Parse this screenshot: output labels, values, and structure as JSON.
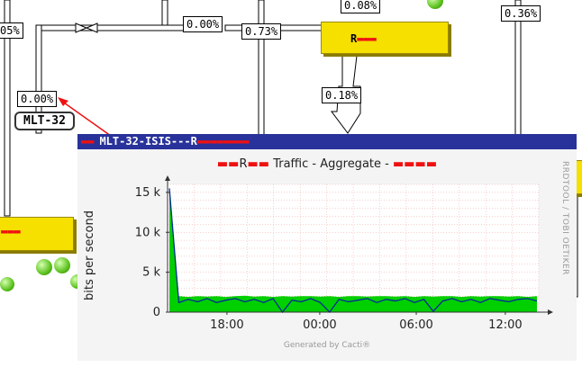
{
  "map": {
    "labels": [
      {
        "id": "lbl-top-left",
        "text": "05%"
      },
      {
        "id": "lbl-top-mid",
        "text": "0.00%"
      },
      {
        "id": "lbl-top-mid2",
        "text": "0.73%"
      },
      {
        "id": "lbl-top-r",
        "text": "0.08%"
      },
      {
        "id": "lbl-top-far",
        "text": "0.36%"
      },
      {
        "id": "lbl-left-mid",
        "text": "0.00%"
      },
      {
        "id": "lbl-center",
        "text": "0.18%"
      }
    ],
    "node_tag": "MLT-32",
    "node_r_prefix": "R"
  },
  "graph": {
    "window_title": "MLT-32-ISIS---R",
    "title_prefix": "R",
    "title_main": "Traffic - Aggregate -",
    "ylabel": "bits per second",
    "side_label": "RRDTOOL / TOBI OETIKER",
    "footer": "Generated by Cacti®",
    "colors": {
      "inbound": "#00cf00",
      "outbound": "#002a97"
    }
  },
  "chart_data": {
    "type": "area",
    "ylabel": "bits per second",
    "yticks": [
      "15 k",
      "10 k",
      "5 k",
      "0"
    ],
    "ytick_values": [
      15000,
      10000,
      5000,
      0
    ],
    "xticks": [
      "18:00",
      "00:00",
      "06:00",
      "12:00"
    ],
    "ylim": [
      0,
      16000
    ],
    "grid": true,
    "series": [
      {
        "name": "",
        "color": "#00cf00",
        "values": [
          15500,
          2000,
          1900,
          2000,
          1950,
          2000,
          1900,
          2000,
          2050,
          1950,
          2000,
          1900,
          2000,
          1950,
          2000,
          2000,
          1950,
          2000,
          1900,
          2000,
          2000,
          1950,
          2000,
          2000,
          1950,
          2000,
          1900,
          2000,
          1950,
          2000,
          2000,
          1900,
          2000,
          1950,
          2000,
          2000,
          1950,
          2000,
          1900,
          2000
        ]
      },
      {
        "name": "",
        "color": "#002a97",
        "values": [
          15500,
          1200,
          1600,
          1300,
          1700,
          1200,
          1500,
          1700,
          1300,
          1600,
          1200,
          1700,
          0,
          1500,
          1300,
          1700,
          1200,
          0,
          1600,
          1300,
          1500,
          1700,
          1200,
          1600,
          1400,
          1700,
          1200,
          1600,
          100,
          1400,
          1700,
          1300,
          1600,
          1200,
          1700,
          1500,
          1300,
          1600,
          1700,
          1400
        ]
      }
    ]
  }
}
